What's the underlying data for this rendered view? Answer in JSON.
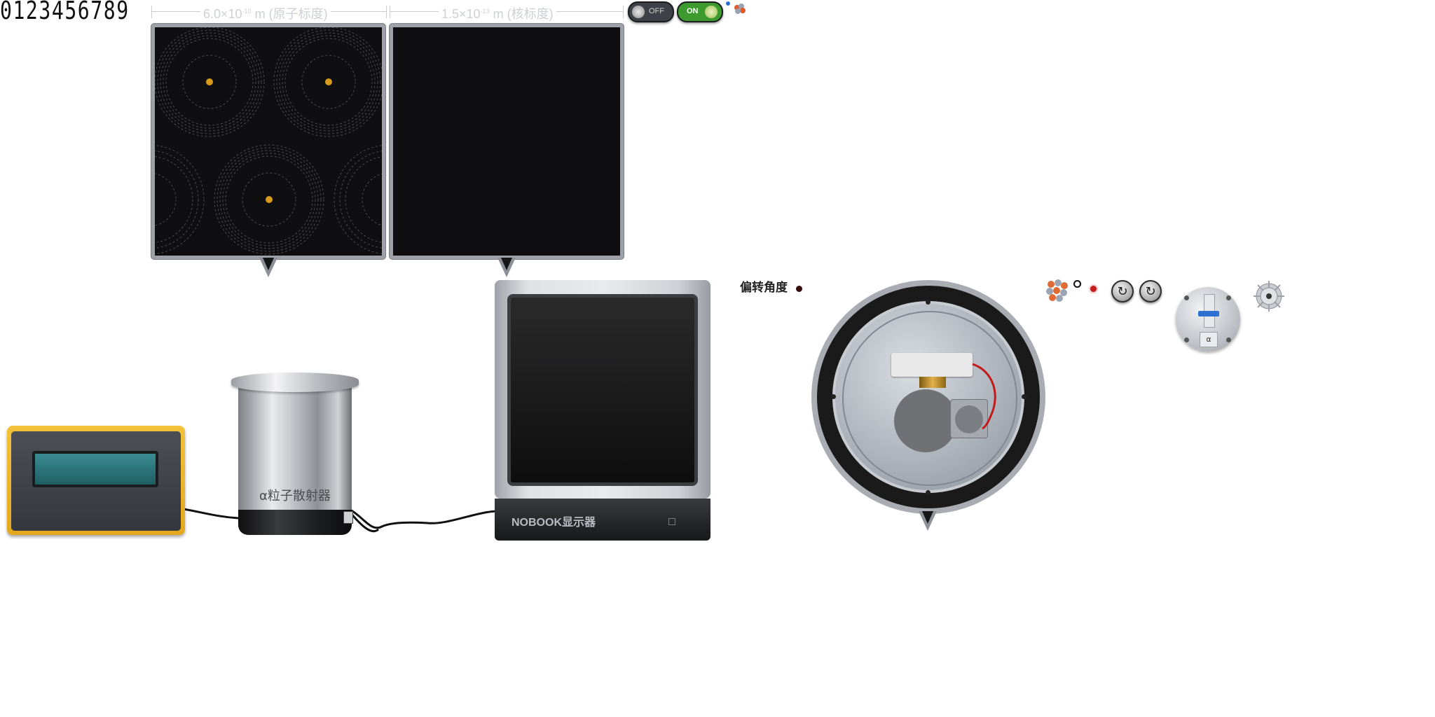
{
  "digit_strip": "0123456789",
  "scales": {
    "atomic": {
      "value": "6.0×10",
      "exp": "-10",
      "unit": "m",
      "label": "(原子标度)"
    },
    "nuclear": {
      "value": "1.5×10",
      "exp": "-13",
      "unit": "m",
      "label": "(核标度)"
    }
  },
  "toggles": {
    "off_label": "OFF",
    "on_label": "ON",
    "off_color": "#3e4148",
    "on_color": "#3c9a2f"
  },
  "scatterer": {
    "label": "α粒子散射器"
  },
  "monitor": {
    "brand": "NOBOOK显示器"
  },
  "deflection": {
    "label": "偏转角度"
  },
  "source": {
    "label": "α"
  },
  "colors": {
    "panel_bg": "#0f0f11",
    "counter_yellow": "#e9b027",
    "lcd_teal": "#2f7b80",
    "indicator_red": "#b01818",
    "nucleus": "#d79a1a"
  }
}
